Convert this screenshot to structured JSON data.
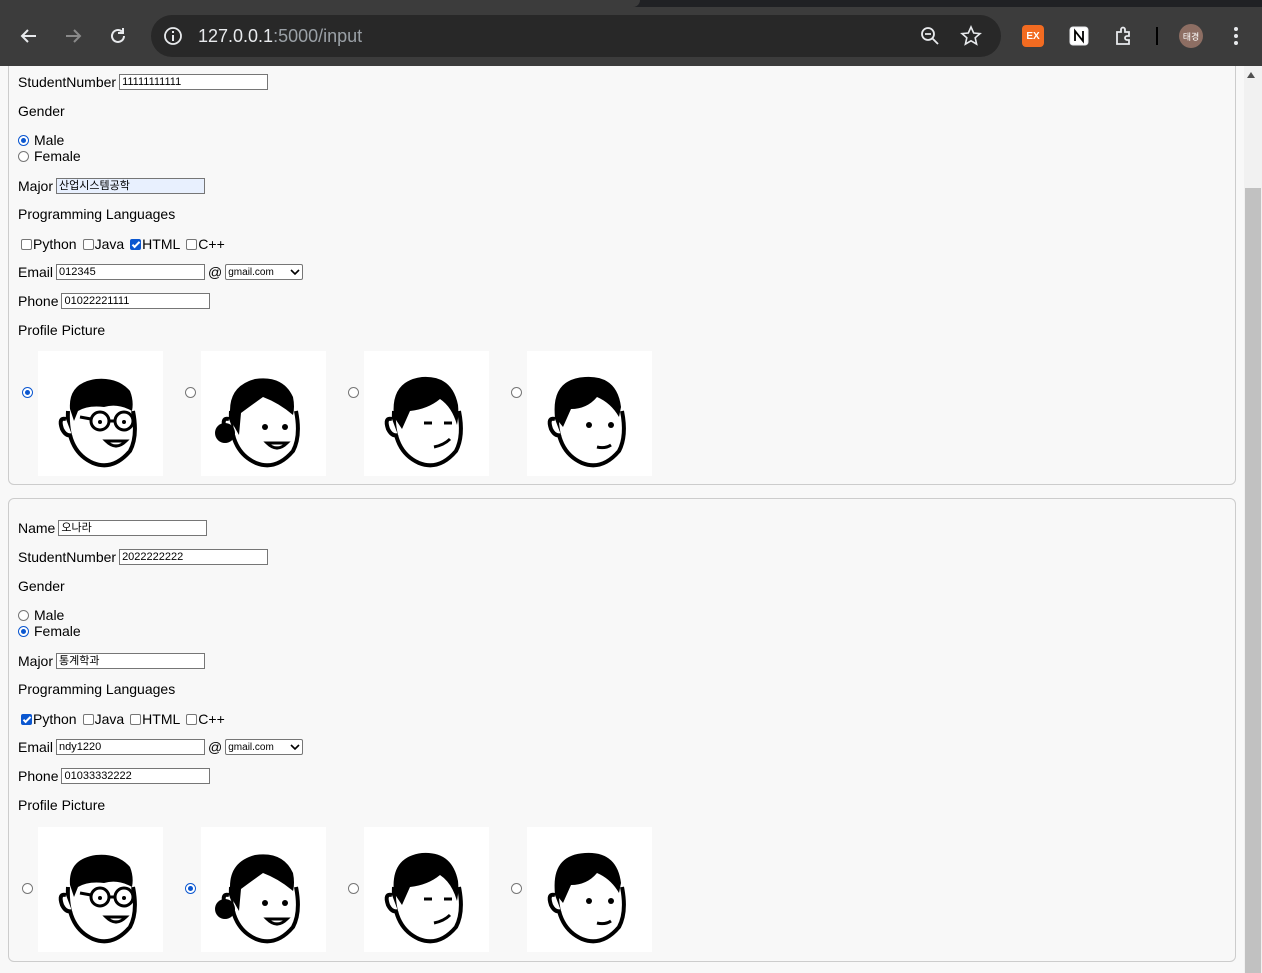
{
  "browser": {
    "url_host": "127.0.0.1",
    "url_path": ":5000/input",
    "ext_label": "EX",
    "profile_label": "태경"
  },
  "form_labels": {
    "name": "Name",
    "student_number": "StudentNumber",
    "gender": "Gender",
    "male": "Male",
    "female": "Female",
    "major": "Major",
    "programming_languages": "Programming Languages",
    "python": "Python",
    "java": "Java",
    "html": "HTML",
    "cpp": "C++",
    "email": "Email",
    "at": "@",
    "phone": "Phone",
    "profile_picture": "Profile Picture"
  },
  "entries": [
    {
      "student_number": "11111111111",
      "gender": "Male",
      "major": "산업시스템공학",
      "languages": [
        "HTML"
      ],
      "email_user": "012345",
      "email_domain": "gmail.com",
      "phone": "01022221111",
      "profile_picture": 1
    },
    {
      "name": "오나라",
      "student_number": "2022222222",
      "gender": "Female",
      "major": "통계학과",
      "languages": [
        "Python"
      ],
      "email_user": "ndy1220",
      "email_domain": "gmail.com",
      "phone": "01033332222",
      "profile_picture": 2
    }
  ],
  "profile_icons": [
    "man-glasses-avatar-icon",
    "woman-bun-avatar-icon",
    "man-bangs-avatar-icon",
    "boy-avatar-icon"
  ]
}
